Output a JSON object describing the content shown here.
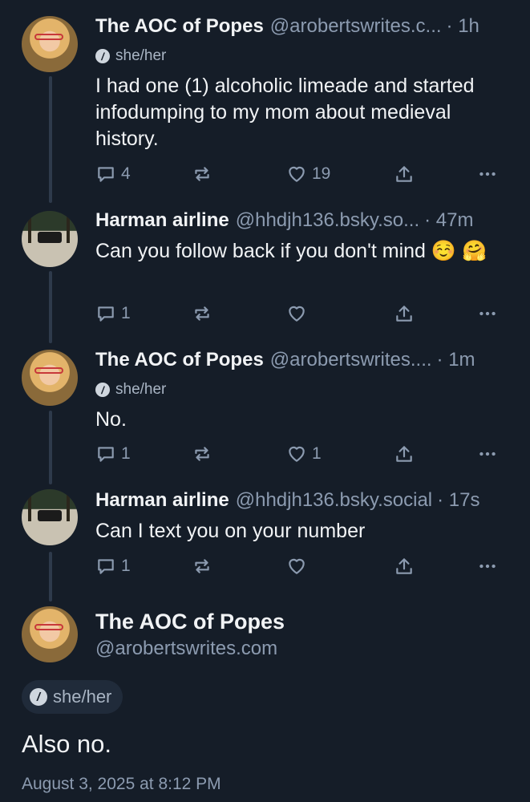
{
  "posts": [
    {
      "name": "The AOC of Popes",
      "handle": "@arobertswrites.c...",
      "time": "· 1h",
      "pronouns": "she/her",
      "text": "I had one (1) alcoholic limeade and started infodumping to my mom about medieval history.",
      "replies": "4",
      "likes": "19",
      "avatar": "aoc-avatar"
    },
    {
      "name": "Harman airline",
      "handle": "@hhdjh136.bsky.so...",
      "time": "· 47m",
      "text": "Can you follow  back if you don't mind ☺️ 🤗",
      "replies": "1",
      "likes": "",
      "avatar": "harman-avatar"
    },
    {
      "name": "The AOC of Popes",
      "handle": "@arobertswrites....",
      "time": "· 1m",
      "pronouns": "she/her",
      "text": "No.",
      "replies": "1",
      "likes": "1",
      "avatar": "aoc-avatar"
    },
    {
      "name": "Harman airline",
      "handle": "@hhdjh136.bsky.social",
      "time": "· 17s",
      "text": "Can I text you on your number",
      "replies": "1",
      "likes": "",
      "avatar": "harman-avatar"
    }
  ],
  "focused": {
    "name": "The AOC of Popes",
    "handle": "@arobertswrites.com",
    "pronouns": "she/her",
    "text": "Also no.",
    "date": "August 3, 2025 at 8:12 PM"
  },
  "icons": {
    "reply": "reply-icon",
    "repost": "repost-icon",
    "like": "heart-icon",
    "share": "share-icon",
    "more": "more-icon",
    "pronoun": "pronoun-icon"
  },
  "colors": {
    "background": "#151d28",
    "muted": "#8c9bb0",
    "text": "#f1f3f5",
    "thread_line": "#2e3a4b"
  }
}
